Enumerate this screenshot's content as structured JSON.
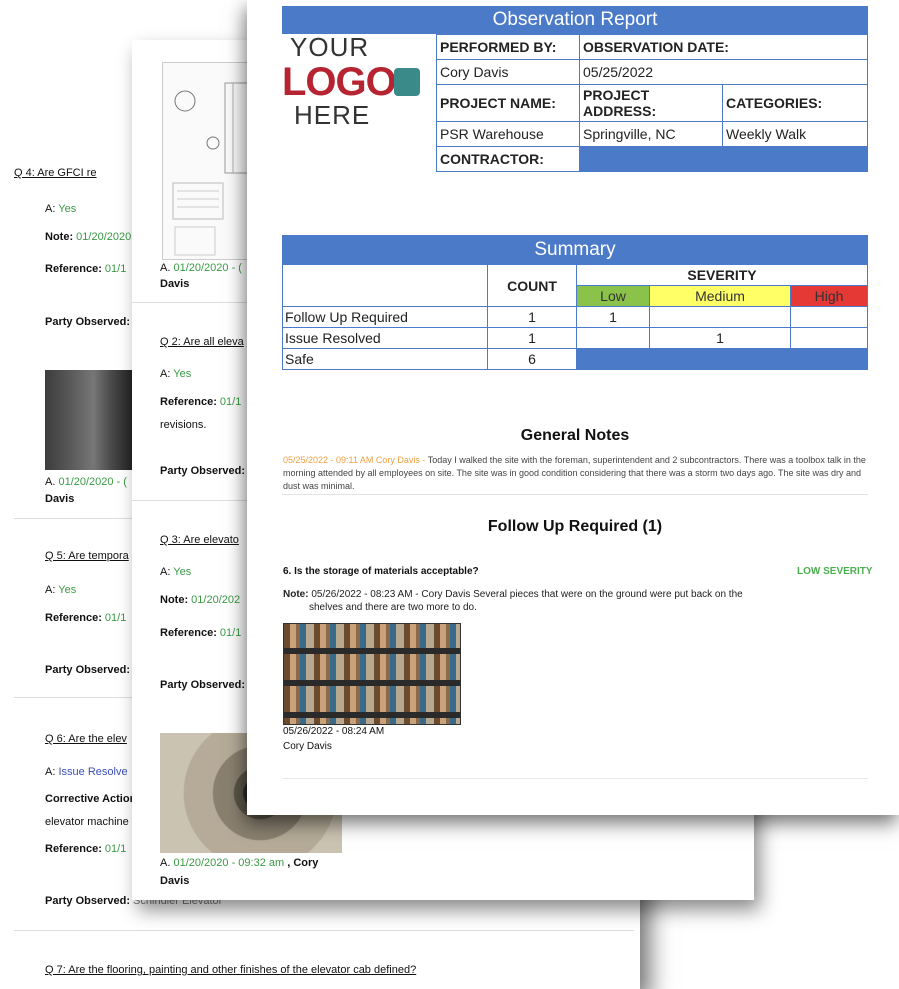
{
  "back_page": {
    "q7": "Q 7: Are the flooring, painting and other finishes of the elevator cab defined?"
  },
  "left_page": {
    "q4": "Q 4: Are GFCI re",
    "q4_answer_label": "A:",
    "q4_answer": "Yes",
    "q4_note_label": "Note:",
    "q4_note": "01/20/2020",
    "q4_ref_label": "Reference:",
    "q4_ref": "01/1",
    "party1": "Party Observed:",
    "photo1_caption_a": "A.",
    "photo1_caption_date": "01/20/2020 - (",
    "photo1_caption_name": "Davis",
    "q5": "Q 5: Are tempora",
    "q5_answer_label": "A:",
    "q5_answer": "Yes",
    "q5_ref_label": "Reference:",
    "q5_ref": "01/1",
    "party2": "Party Observed:",
    "q6": "Q 6: Are the elev",
    "q6_answer_label": "A:",
    "q6_answer": "Issue Resolve",
    "q6_ca": "Corrective Action",
    "q6_ca2": "elevator machine",
    "q6_ref_label": "Reference:",
    "q6_ref": "01/1",
    "party3": "Party Observed:",
    "party3_tail": "Schindler Elevator"
  },
  "mid_page": {
    "drawing_caption_a": "A.",
    "drawing_caption_date": "01/20/2020 - (",
    "drawing_caption_name": "Davis",
    "q2": "Q 2: Are all eleva",
    "q2_answer_label": "A:",
    "q2_answer": "Yes",
    "q2_ref_label": "Reference:",
    "q2_ref": "01/1",
    "q2_tail": "revisions.",
    "party1": "Party Observed:",
    "q3": "Q 3: Are elevato",
    "q3_answer_label": "A:",
    "q3_answer": "Yes",
    "q3_note_label": "Note:",
    "q3_note": "01/20/202",
    "q3_ref_label": "Reference:",
    "q3_ref": "01/1",
    "party2": "Party Observed:",
    "photo_caption_a": "A.",
    "photo_caption_date": "01/20/2020 - 09:32 am",
    "photo_caption_sep": ", Cory",
    "photo_caption_name": "Davis"
  },
  "report": {
    "title": "Observation Report",
    "logo": {
      "line1": "YOUR",
      "line2": "LOGO",
      "line3": "HERE"
    },
    "performed_by_label": "PERFORMED BY:",
    "performed_by": "Cory Davis",
    "observation_date_label": "OBSERVATION DATE:",
    "observation_date": "05/25/2022",
    "project_name_label": "PROJECT NAME:",
    "project_name": "PSR Warehouse",
    "project_address_label": "PROJECT ADDRESS:",
    "project_address": "Springville, NC",
    "categories_label": "CATEGORIES:",
    "categories": "Weekly Walk",
    "contractor_label": "CONTRACTOR:",
    "accent_color": "#4a7ac8"
  },
  "summary": {
    "title": "Summary",
    "count_header": "COUNT",
    "severity_header": "SEVERITY",
    "low": "Low",
    "medium": "Medium",
    "high": "High",
    "rows": [
      {
        "label": "Follow Up Required",
        "count": "1",
        "low": "1",
        "medium": "",
        "high": ""
      },
      {
        "label": "Issue Resolved",
        "count": "1",
        "low": "",
        "medium": "1",
        "high": ""
      },
      {
        "label": "Safe",
        "count": "6"
      }
    ]
  },
  "general_notes": {
    "title": "General Notes",
    "stamp": "05/25/2022 - 09:11 AM Cory Davis -",
    "text": "Today I walked the site with the foreman, superintendent and 2 subcontractors. There was a toolbox talk in the morning attended by all employees on site. The site was in good condition considering that there was a storm two days ago. The site was dry and dust was minimal."
  },
  "follow_up": {
    "title": "Follow Up Required (1)",
    "question": "6. Is the storage of materials acceptable?",
    "severity": "LOW SEVERITY",
    "note_label": "Note:",
    "note": "05/26/2022 - 08:23 AM - Cory Davis Several pieces that were on the ground were put back on the shelves and there are two more to do.",
    "photo_date": "05/26/2022 - 08:24 AM",
    "photo_author": "Cory Davis"
  }
}
